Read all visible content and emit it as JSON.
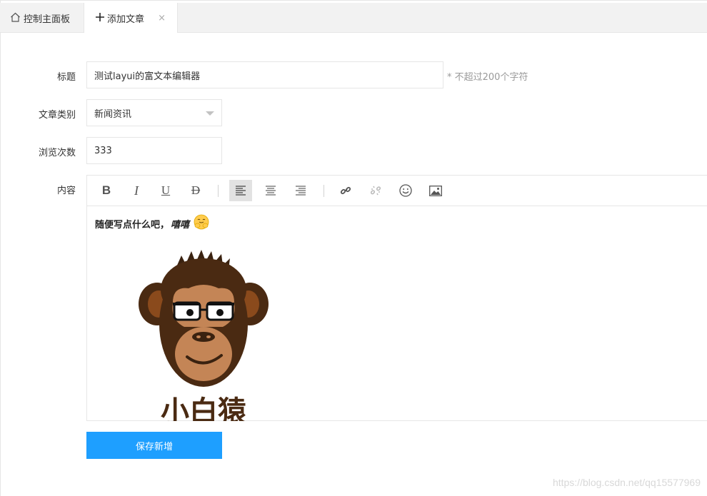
{
  "tabs": [
    {
      "label": "控制主面板",
      "icon": "home-icon"
    },
    {
      "label": "添加文章",
      "icon": "plus-icon",
      "close": "×"
    }
  ],
  "form": {
    "title": {
      "label": "标题",
      "value": "测试layui的富文本编辑器",
      "hint": "* 不超过200个字符"
    },
    "category": {
      "label": "文章类别",
      "value": "新闻资讯"
    },
    "views": {
      "label": "浏览次数",
      "value": "333"
    },
    "content": {
      "label": "内容"
    }
  },
  "editor": {
    "toolbar": [
      {
        "name": "bold-icon",
        "glyph": "B"
      },
      {
        "name": "italic-icon",
        "glyph": "I"
      },
      {
        "name": "underline-icon",
        "glyph": "U"
      },
      {
        "name": "strikethrough-icon",
        "glyph": "D"
      },
      {
        "name": "align-left-icon",
        "active": true
      },
      {
        "name": "align-center-icon"
      },
      {
        "name": "align-right-icon"
      },
      {
        "name": "link-icon"
      },
      {
        "name": "unlink-icon"
      },
      {
        "name": "emoji-icon"
      },
      {
        "name": "image-icon"
      }
    ],
    "body_text": "随便写点什么吧，",
    "body_italic": "嘻嘻",
    "image_caption": "小白猿"
  },
  "save_button": "保存新增",
  "watermark": "https://blog.csdn.net/qq15577969",
  "colors": {
    "primary": "#1e9fff",
    "border": "#e6e6e6",
    "tabbar": "#f2f2f2"
  }
}
